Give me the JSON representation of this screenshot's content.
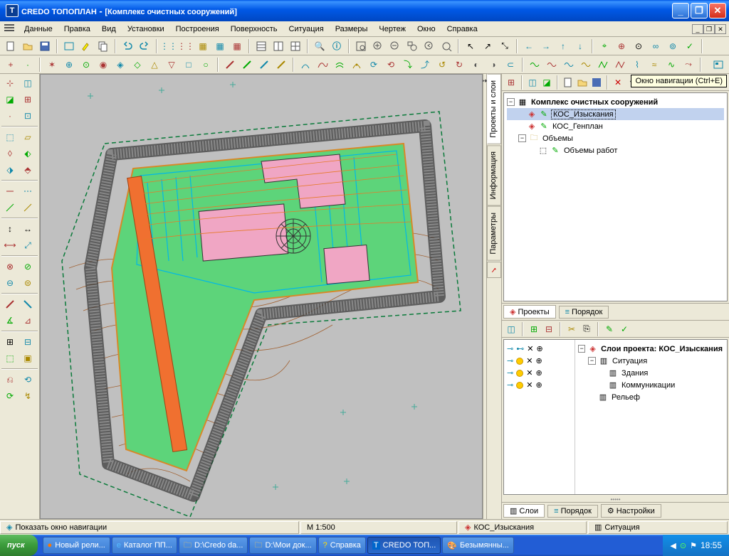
{
  "window": {
    "app": "CREDO ТОПОПЛАН",
    "doc": "[Комплекс очистных сооружений]"
  },
  "menu": [
    "Данные",
    "Правка",
    "Вид",
    "Установки",
    "Построения",
    "Поверхность",
    "Ситуация",
    "Размеры",
    "Чертеж",
    "Окно",
    "Справка"
  ],
  "tooltip": "Окно навигации (Ctrl+E)",
  "sidetabs": [
    "Проекты и слои",
    "Информация",
    "Параметры"
  ],
  "projects": {
    "root": "Комплекс очистных сооружений",
    "items": [
      "КОС_Изыскания",
      "КОС_Генплан",
      "Объемы",
      "Объемы работ"
    ]
  },
  "project_tabs": [
    "Проекты",
    "Порядок"
  ],
  "layers": {
    "title": "Слои проекта: КОС_Изыскания",
    "items": [
      "Ситуация",
      "Здания",
      "Коммуникации",
      "Рельеф"
    ]
  },
  "layer_tabs": [
    "Слои",
    "Порядок",
    "Настройки"
  ],
  "status": {
    "nav": "Показать окно навигации",
    "scale": "М 1:500",
    "proj": "КОС_Изыскания",
    "sit": "Ситуация"
  },
  "taskbar": {
    "start": "пуск",
    "tasks": [
      "Новый рели...",
      "Каталог ПП...",
      "D:\\Credo da...",
      "D:\\Мои док...",
      "Справка",
      "CREDO ТОП...",
      "Безымянны..."
    ],
    "clock": "18:55"
  }
}
